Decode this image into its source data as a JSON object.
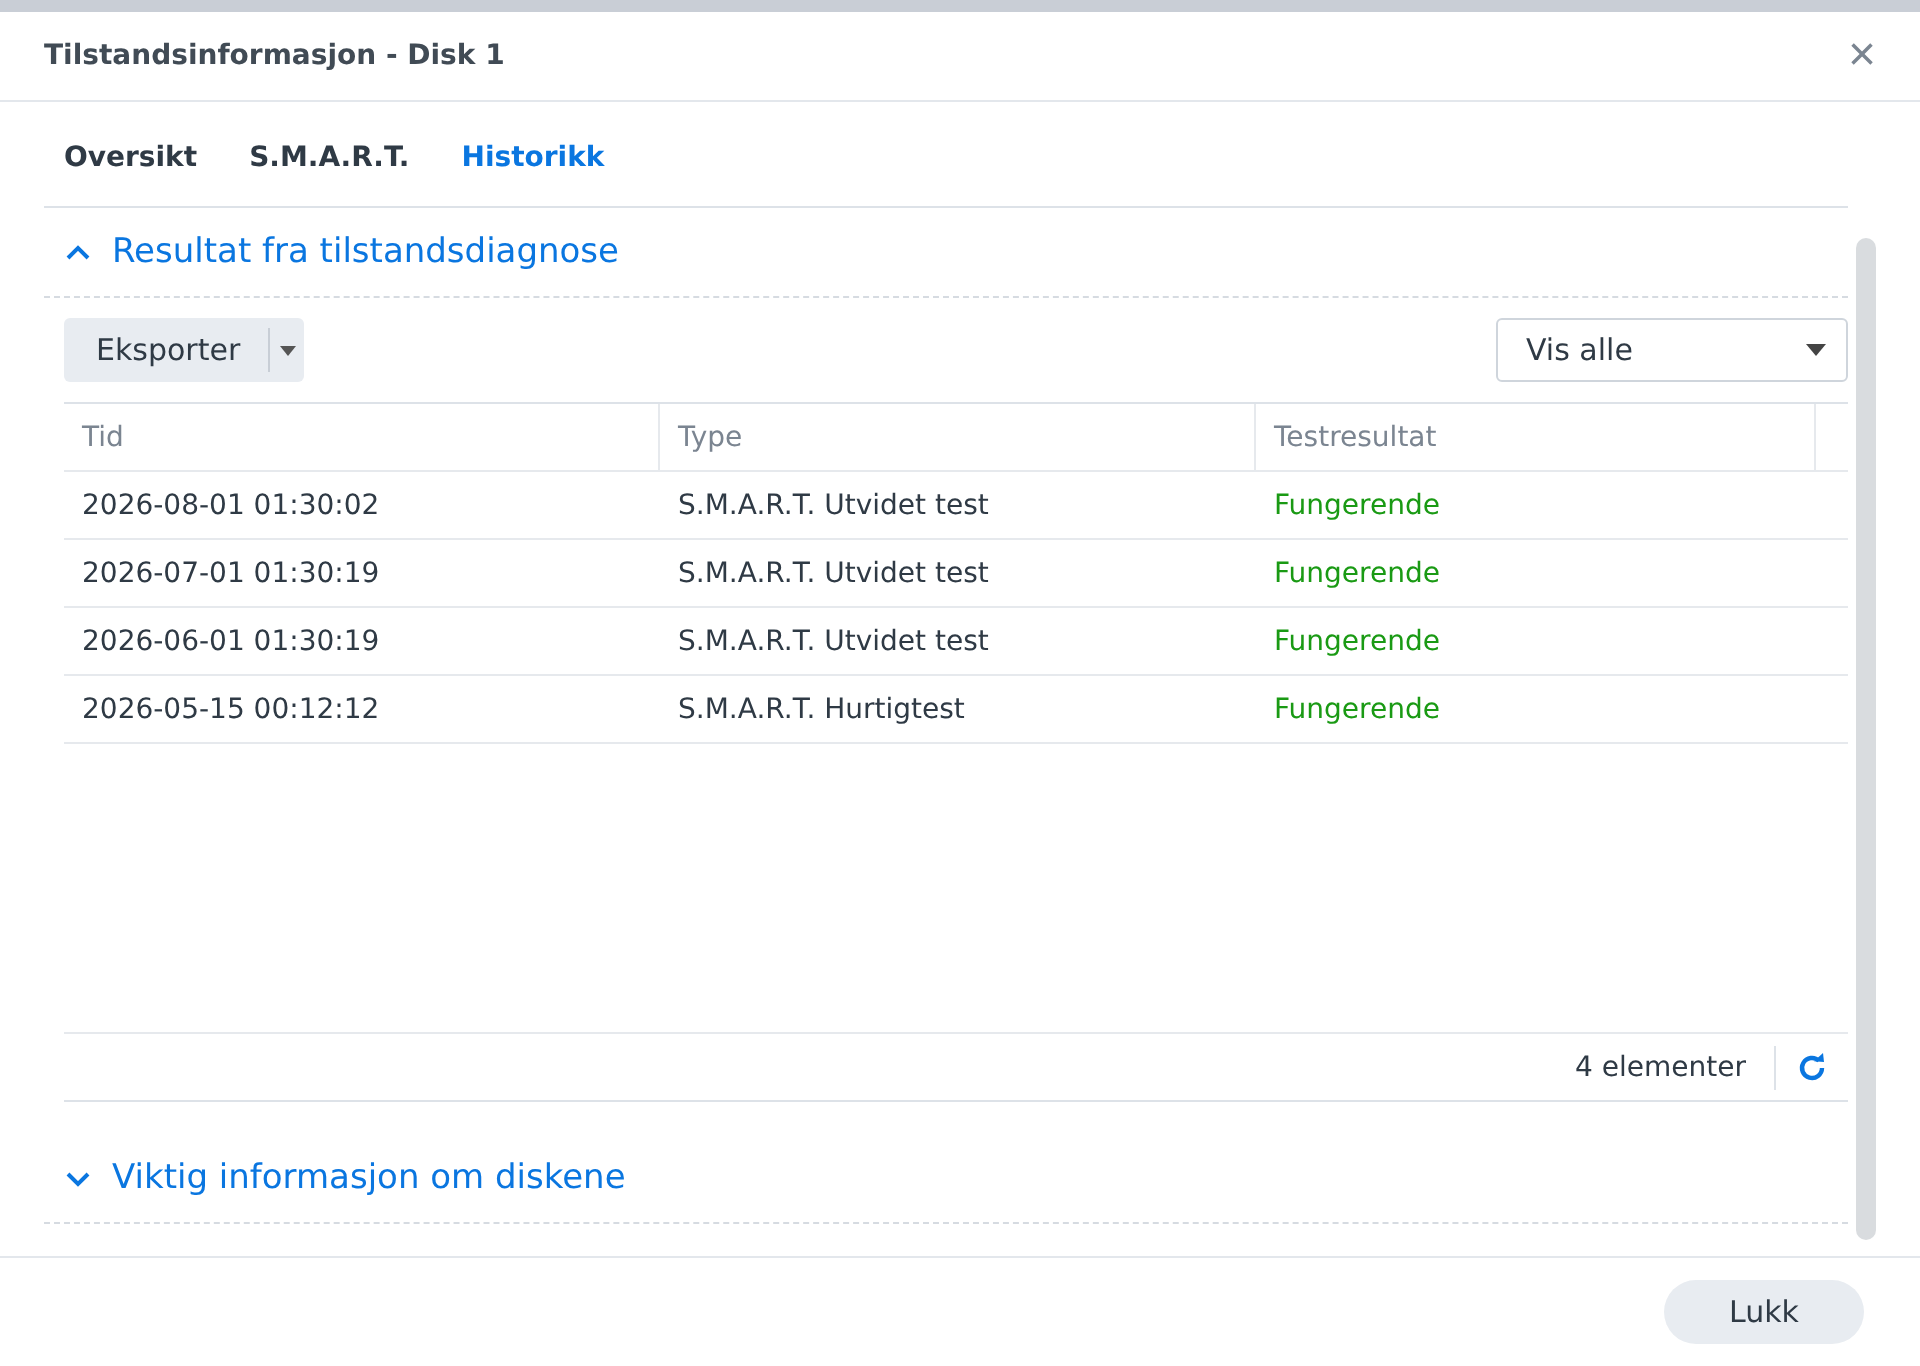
{
  "window": {
    "title": "Tilstandsinformasjon - Disk 1",
    "close": "×"
  },
  "tabs": [
    {
      "label": "Oversikt",
      "selected": false
    },
    {
      "label": "S.M.A.R.T.",
      "selected": false
    },
    {
      "label": "Historikk",
      "selected": true
    }
  ],
  "sections": [
    {
      "title": "Resultat fra tilstandsdiagnose",
      "expanded": true
    },
    {
      "title": "Viktig informasjon om diskene",
      "expanded": false
    }
  ],
  "toolbar": {
    "export_button": "Eksporter",
    "filter": "Vis alle"
  },
  "table": {
    "columns": [
      "Tid",
      "Type",
      "Testresultat"
    ],
    "rows": [
      {
        "time": "2026-08-01 01:30:02",
        "type": "S.M.A.R.T. Utvidet test",
        "result": "Fungerende",
        "color": "#1a9a14"
      },
      {
        "time": "2026-07-01 01:30:19",
        "type": "S.M.A.R.T. Utvidet test",
        "result": "Fungerende",
        "color": "#1a9a14"
      },
      {
        "time": "2026-06-01 01:30:19",
        "type": "S.M.A.R.T. Utvidet test",
        "result": "Fungerende",
        "color": "#1a9a14"
      },
      {
        "time": "2026-05-15 00:12:12",
        "type": "S.M.A.R.T. Hurtigtest",
        "result": "Fungerende",
        "color": "#1a9a14"
      }
    ],
    "count": "4 elementer"
  },
  "buttons": [
    "Lukk"
  ]
}
